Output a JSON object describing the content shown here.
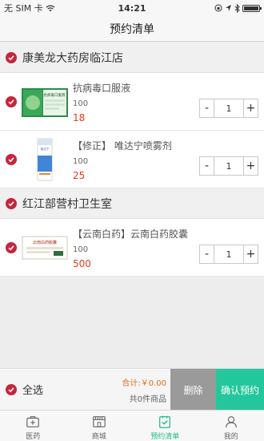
{
  "status_bar": {
    "carrier": "无 SIM 卡",
    "time": "14:21"
  },
  "nav": {
    "title": "预约清单"
  },
  "stores": [
    {
      "name": "康美龙大药房临江店",
      "items": [
        {
          "name": "抗病毒口服液",
          "spec": "100",
          "price": "18",
          "qty": "1",
          "thumb_text": "抗病毒口服液"
        },
        {
          "name": "【修正】 唯达宁喷雾剂",
          "spec": "100",
          "price": "25",
          "qty": "1",
          "thumb_text": "唯达宁"
        }
      ]
    },
    {
      "name": "红江部营村卫生室",
      "items": [
        {
          "name": "【云南白药】云南白药胶囊",
          "spec": "100",
          "price": "500",
          "qty": "1",
          "thumb_text": "云南白药胶囊"
        }
      ]
    }
  ],
  "stepper": {
    "minus": "-",
    "plus": "+"
  },
  "bottom": {
    "select_all": "全选",
    "total": "合计:￥0.00",
    "count": "共0件商品",
    "delete": "删除",
    "confirm": "确认预约"
  },
  "tabs": [
    {
      "label": "医药",
      "icon": "medicine-box-icon"
    },
    {
      "label": "商城",
      "icon": "shop-icon"
    },
    {
      "label": "预约清单",
      "icon": "appointment-list-icon",
      "active": true
    },
    {
      "label": "我的",
      "icon": "user-icon"
    }
  ],
  "colors": {
    "accent": "#24c79b",
    "check": "#c8243c",
    "price": "#e03c1e",
    "delete_bg": "#9a9a9a"
  }
}
